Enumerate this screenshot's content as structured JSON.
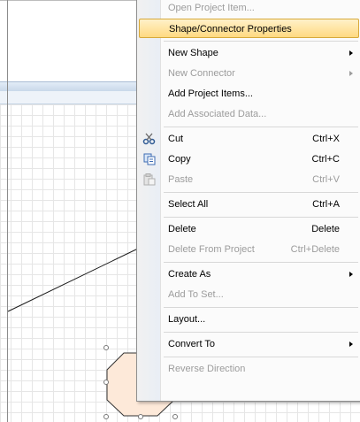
{
  "colors": {
    "menu_highlight": "#ffd981",
    "disabled_text": "#9c9c9c",
    "shape_fill": "#fde9d9"
  },
  "menu": {
    "items": [
      {
        "label": "Open Project Item...",
        "disabled": true
      },
      {
        "label": "Shape/Connector Properties",
        "highlighted": true
      },
      {
        "label": "New Shape",
        "submenu": true
      },
      {
        "label": "New Connector",
        "submenu": true,
        "disabled": true
      },
      {
        "label": "Add Project Items..."
      },
      {
        "label": "Add Associated Data...",
        "disabled": true
      },
      {
        "label": "Cut",
        "shortcut": "Ctrl+X",
        "icon": "scissors-icon"
      },
      {
        "label": "Copy",
        "shortcut": "Ctrl+C",
        "icon": "copy-icon"
      },
      {
        "label": "Paste",
        "shortcut": "Ctrl+V",
        "icon": "paste-icon",
        "disabled": true
      },
      {
        "label": "Select All",
        "shortcut": "Ctrl+A"
      },
      {
        "label": "Delete",
        "shortcut": "Delete"
      },
      {
        "label": "Delete From Project",
        "shortcut": "Ctrl+Delete",
        "disabled": true
      },
      {
        "label": "Create As",
        "submenu": true
      },
      {
        "label": "Add To Set...",
        "disabled": true
      },
      {
        "label": "Layout..."
      },
      {
        "label": "Convert To",
        "submenu": true
      },
      {
        "label": "Reverse Direction",
        "disabled": true
      }
    ]
  }
}
